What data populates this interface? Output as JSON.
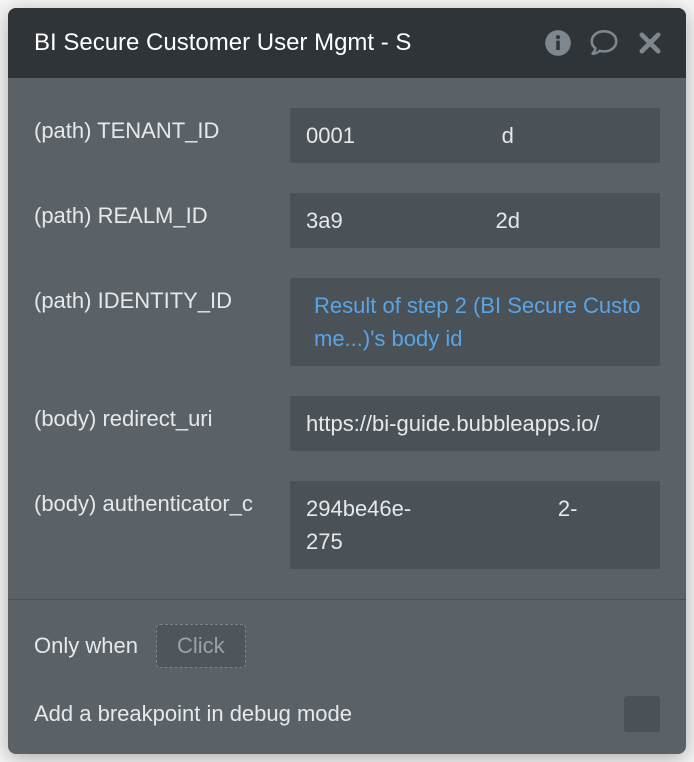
{
  "header": {
    "title": "BI Secure Customer User Mgmt - S"
  },
  "fields": [
    {
      "label": "(path) TENANT_ID",
      "value": "0001                        d",
      "type": "text"
    },
    {
      "label": "(path) REALM_ID",
      "value": "3a9                         2d",
      "type": "text"
    },
    {
      "label": "(path) IDENTITY_ID",
      "value": "Result of step 2 (BI Secure Custome...)'s body id",
      "type": "expression"
    },
    {
      "label": "(body) redirect_uri",
      "value": "https://bi-guide.bubbleapps.io/",
      "type": "text"
    },
    {
      "label": "(body) authenticator_c",
      "value": "294be46e-                        2-                         275",
      "type": "text"
    }
  ],
  "onlyWhen": {
    "label": "Only when",
    "placeholder": "Click"
  },
  "breakpoint": {
    "label": "Add a breakpoint in debug mode"
  }
}
